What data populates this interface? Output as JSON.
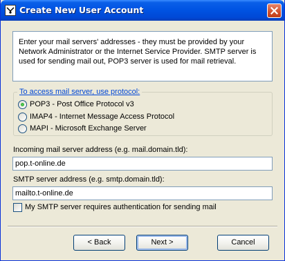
{
  "window": {
    "title": "Create New User Account",
    "icon": "app-icon",
    "close_icon": "close-icon"
  },
  "info": {
    "text": "Enter your mail servers' addresses - they must be provided by your Network Administrator or the Internet Service Provider. SMTP server is used for sending mail out, POP3 server is used for mail retrieval."
  },
  "protocol": {
    "title": "To access mail server, use protocol:",
    "options": [
      {
        "label": "POP3  -  Post Office Protocol v3",
        "checked": true
      },
      {
        "label": "IMAP4 - Internet Message Access Protocol",
        "checked": false
      },
      {
        "label": "MAPI - Microsoft Exchange Server",
        "checked": false
      }
    ]
  },
  "incoming": {
    "label": "Incoming mail server address (e.g. mail.domain.tld):",
    "value": "pop.t-online.de"
  },
  "smtp": {
    "label": "SMTP server address (e.g. smtp.domain.tld):",
    "value": "mailto.t-online.de"
  },
  "auth": {
    "label": "My SMTP server requires authentication for sending mail",
    "checked": false
  },
  "buttons": {
    "back": "< Back",
    "next": "Next >",
    "cancel": "Cancel"
  },
  "colors": {
    "titlebar": "#0054e3",
    "dialog_bg": "#ece9d8",
    "group_title": "#0046d5",
    "field_border": "#7f9db9"
  }
}
